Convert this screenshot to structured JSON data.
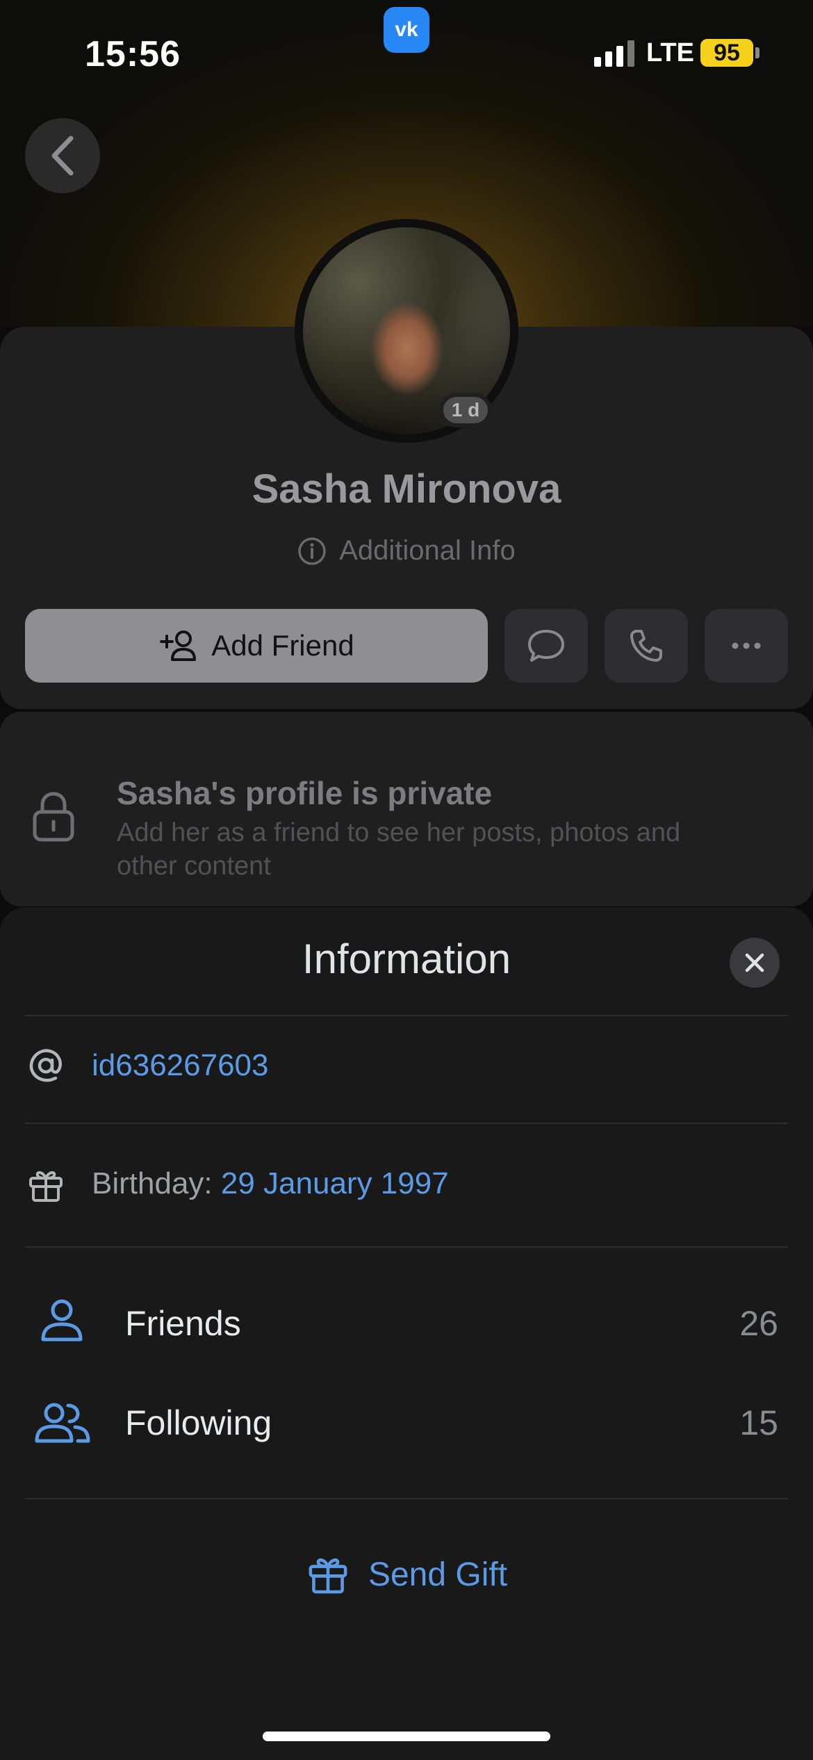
{
  "status_bar": {
    "time": "15:56",
    "network": "LTE",
    "battery": "95",
    "app_badge": "vk"
  },
  "profile": {
    "name": "Sasha Mironova",
    "story_age": "1 d",
    "additional_info_label": "Additional Info",
    "add_friend_label": "Add Friend"
  },
  "private_notice": {
    "title": "Sasha's profile is private",
    "description": "Add her as a friend to see her posts, photos and other content"
  },
  "sheet": {
    "title": "Information",
    "user_id": "id636267603",
    "birthday_label": "Birthday: ",
    "birthday_value": "29 January 1997",
    "friends_label": "Friends",
    "friends_count": "26",
    "following_label": "Following",
    "following_count": "15",
    "send_gift_label": "Send Gift"
  },
  "colors": {
    "accent": "#5b9be6",
    "sheet_bg": "#19191a",
    "card_bg": "#1f1f20",
    "battery": "#f7d21c",
    "vk_blue": "#2787f5"
  }
}
